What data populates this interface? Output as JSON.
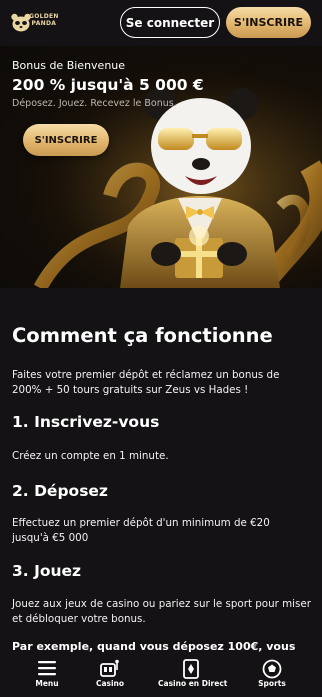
{
  "header": {
    "logo_text_line1": "GOLDEN",
    "logo_text_line2": "PANDA",
    "login_label": "Se connecter",
    "signup_label": "S'INSCRIRE"
  },
  "hero": {
    "kicker": "Bonus de Bienvenue",
    "title": "200 % jusqu'à 5 000 €",
    "subtitle": "Déposez. Jouez. Recevez le Bonus.",
    "cta_label": "S'INSCRIRE"
  },
  "content": {
    "heading": "Comment ça fonctionne",
    "intro": "Faites votre premier dépôt et réclamez un bonus de 200% + 50 tours gratuits sur Zeus vs Hades !",
    "steps": [
      {
        "title": "1. Inscrivez-vous",
        "text": "Créez un compte en 1 minute."
      },
      {
        "title": "2. Déposez",
        "text": "Effectuez un premier dépôt d'un minimum de €20 jusqu'à €5 000"
      },
      {
        "title": "3. Jouez",
        "text": "Jouez aux jeux de casino ou pariez sur le sport pour miser et débloquer votre bonus."
      }
    ],
    "example": "Par exemple, quand vous déposez 100€, vous"
  },
  "bottom_nav": {
    "items": [
      {
        "label": "Menu",
        "icon": "menu-icon"
      },
      {
        "label": "Casino",
        "icon": "casino-icon"
      },
      {
        "label": "Casino en Direct",
        "icon": "live-casino-icon"
      },
      {
        "label": "Sports",
        "icon": "sports-icon"
      }
    ]
  },
  "colors": {
    "background": "#141214",
    "gold_light": "#f6dca6",
    "gold_dark": "#c99a52"
  }
}
